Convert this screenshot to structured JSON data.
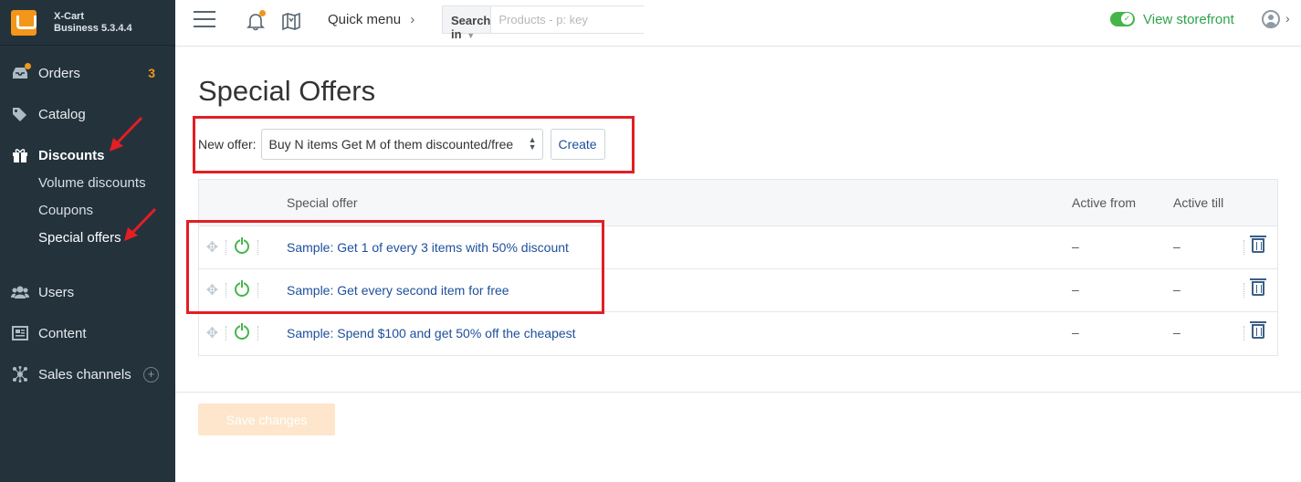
{
  "app": {
    "name": "X-Cart",
    "edition": "Business 5.3.4.4"
  },
  "sidebar": {
    "items": [
      {
        "label": "Orders",
        "icon": "inbox-icon",
        "badge": "3"
      },
      {
        "label": "Catalog",
        "icon": "tags-icon"
      },
      {
        "label": "Discounts",
        "icon": "gift-icon"
      },
      {
        "label": "Volume discounts"
      },
      {
        "label": "Coupons"
      },
      {
        "label": "Special offers"
      },
      {
        "label": "Users",
        "icon": "users-icon"
      },
      {
        "label": "Content",
        "icon": "newspaper-icon"
      },
      {
        "label": "Sales channels",
        "icon": "network-icon",
        "action": "+"
      }
    ]
  },
  "topbar": {
    "quick_menu": "Quick menu",
    "search_in": "Search in",
    "search_placeholder": "Products - p: key",
    "view_storefront": "View storefront"
  },
  "page": {
    "title": "Special Offers",
    "new_offer_label": "New offer:",
    "new_offer_selected": "Buy N items Get M of them discounted/free",
    "create_label": "Create",
    "save_label": "Save changes"
  },
  "table": {
    "columns": [
      "Special offer",
      "Active from",
      "Active till"
    ],
    "rows": [
      {
        "name": "Sample: Get 1 of every 3 items with 50% discount",
        "from": "–",
        "till": "–",
        "enabled": true
      },
      {
        "name": "Sample: Get every second item for free",
        "from": "–",
        "till": "–",
        "enabled": true
      },
      {
        "name": "Sample: Spend $100 and get 50% off the cheapest",
        "from": "–",
        "till": "–",
        "enabled": true
      }
    ]
  },
  "colors": {
    "sidebar_bg": "#24323c",
    "accent_orange": "#f39619",
    "link_blue": "#1d4f9c",
    "success_green": "#45b54a",
    "annotation_red": "#e31e24"
  }
}
